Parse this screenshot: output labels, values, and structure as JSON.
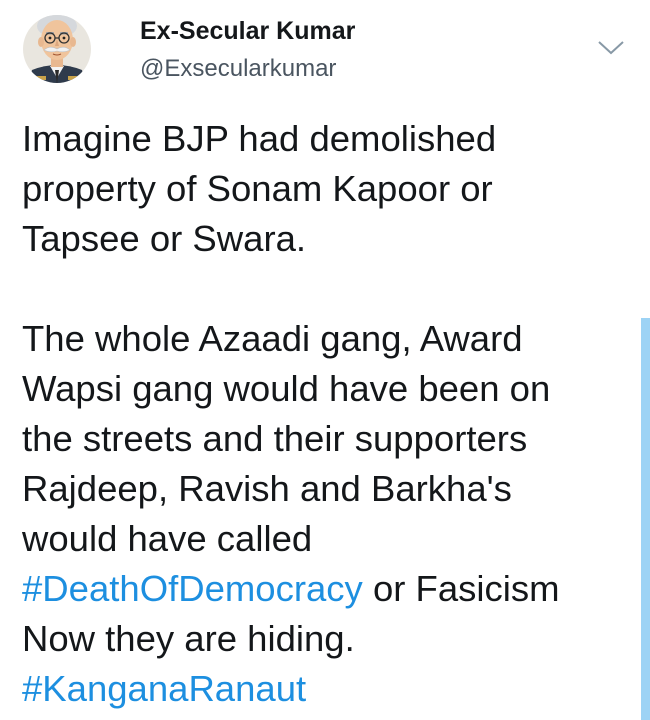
{
  "author": {
    "display_name": "Ex-Secular Kumar",
    "handle": "@Exsecularkumar",
    "avatar_icon": "cartoon-avatar-icon"
  },
  "menu": {
    "icon": "chevron-down-icon"
  },
  "tweet": {
    "paragraph1": {
      "line1": "Imagine BJP had demolished",
      "line2": "property of Sonam Kapoor or",
      "line3": "Tapsee or Swara."
    },
    "paragraph2": {
      "line1": "The whole Azaadi gang, Award",
      "line2": "Wapsi gang would have been on",
      "line3": "the streets and their supporters",
      "line4": "Rajdeep, Ravish and Barkha's",
      "line5": "would have called",
      "hashtag1": "#DeathOfDemocracy",
      "line6_rest": " or Fasicism",
      "line7": "Now they are hiding.",
      "hashtag2": "#KanganaRanaut"
    }
  },
  "colors": {
    "text": "#14171a",
    "handle": "#4a5560",
    "link": "#1d8fe0",
    "side_bar": "#9dd3f5"
  }
}
